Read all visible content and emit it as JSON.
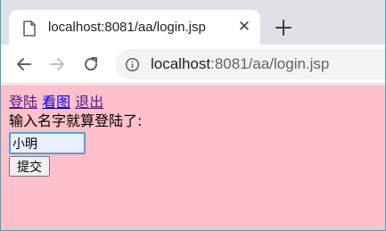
{
  "browser": {
    "tab": {
      "title": "localhost:8081/aa/login.jsp",
      "close_glyph": "✕",
      "icon": "document-icon"
    },
    "new_tab_icon": "plus-icon",
    "toolbar": {
      "back_icon": "arrow-left-icon",
      "forward_icon": "arrow-right-icon",
      "reload_icon": "reload-icon",
      "info_icon": "info-icon",
      "url_host": "localhost",
      "url_rest": ":8081/aa/login.jsp"
    }
  },
  "page": {
    "background": "#ffc0cb",
    "nav_links": [
      {
        "label": "登陆"
      },
      {
        "label": "看图"
      },
      {
        "label": "退出"
      }
    ],
    "prompt": "输入名字就算登陆了:",
    "name_input_value": "小明",
    "submit_label": "提交"
  }
}
